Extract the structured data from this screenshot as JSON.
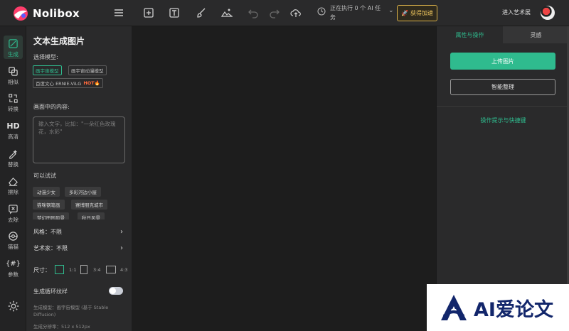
{
  "app": {
    "name": "Nolibox"
  },
  "topbar": {
    "task_status": "正在执行 0 个 AI 任务",
    "speed_button": "获得加速",
    "gallery_link": "进入艺术展",
    "icons": [
      "menu-icon",
      "add-frame-icon",
      "text-icon",
      "brush-icon",
      "image-icon",
      "undo-icon",
      "redo-icon",
      "cloud-upload-icon",
      "clock-icon"
    ]
  },
  "rail": {
    "items": [
      {
        "label": "生成",
        "icon": "generate-icon",
        "active": true
      },
      {
        "label": "相似",
        "icon": "similar-icon"
      },
      {
        "label": "转换",
        "icon": "convert-icon"
      },
      {
        "label": "高清",
        "icon": "hd-icon",
        "glyph": "HD"
      },
      {
        "label": "替换",
        "icon": "replace-icon"
      },
      {
        "label": "擦除",
        "icon": "erase-icon"
      },
      {
        "label": "去除",
        "icon": "remove-icon"
      },
      {
        "label": "猫猫",
        "icon": "cat-icon"
      },
      {
        "label": "参数",
        "icon": "params-icon",
        "glyph": "{#}"
      }
    ],
    "settings_icon": "gear-icon"
  },
  "panel": {
    "title": "文本生成图片",
    "model_label": "选择模型:",
    "models": [
      {
        "label": "画宇宙模型",
        "selected": true
      },
      {
        "label": "画宇宙动漫模型",
        "selected": false
      },
      {
        "label": "百度文心 ERNIE-ViLG",
        "badge": "HOT🔥",
        "selected": false
      }
    ],
    "content_label": "画面中的内容:",
    "prompt_placeholder": "输入文字，比如：\"一朵红色玫瑰花，水彩\"",
    "try_label": "可以试试",
    "try_tags": [
      "动漫少女",
      "多彩河边小屋",
      "猫咪钢笔画",
      "赛博朋克城市",
      "梦幻田园风景",
      "秋日风景"
    ],
    "style_row": "风格：不限",
    "artist_row": "艺术家：不限",
    "size_label": "尺寸：",
    "ratios": [
      "1:1",
      "3:4",
      "4:3"
    ],
    "loop_texture_label": "生成循环纹样",
    "loop_texture_on": false,
    "model_note": "生成模型：画宇宙模型 (基于 Stable Diffusion)",
    "resolution_note": "生成分辨率：512 x 512px"
  },
  "right_panel": {
    "tabs": [
      {
        "label": "属性与操作",
        "active": true
      },
      {
        "label": "灵感",
        "active": false
      }
    ],
    "upload_button": "上传图片",
    "arrange_button": "智能整理",
    "tips_link": "操作提示与快捷键"
  },
  "watermark": {
    "text": "AI爱论文",
    "icon": "ai-logo-icon"
  },
  "colors": {
    "accent": "#2fbb8e",
    "background": "#1e1e1e",
    "panel": "#2a2a2b",
    "speed_border": "#d8b04a",
    "watermark_text": "#12266b"
  }
}
